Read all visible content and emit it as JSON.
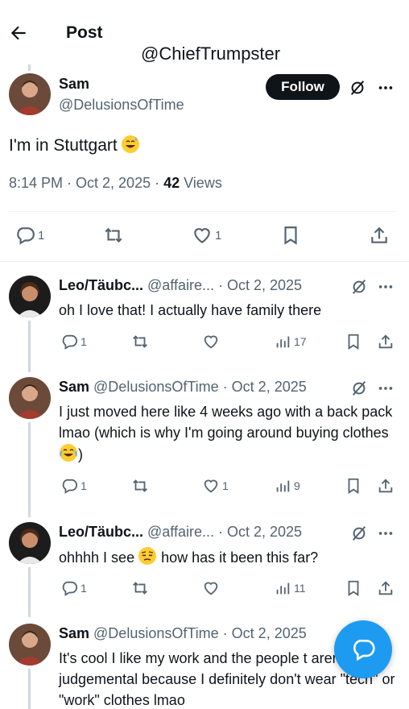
{
  "header": {
    "title": "Post",
    "back_icon": "arrow-left-icon"
  },
  "watermark": "@ChiefTrumpster",
  "main_post": {
    "name": "Sam",
    "handle": "@DelusionsOfTime",
    "follow_label": "Follow",
    "text": "I'm in Stuttgart",
    "text_emoji": "grinning-sweat-emoji",
    "time": "8:14 PM · Oct 2, 2025 · ",
    "views_count": "42",
    "views_label": " Views",
    "actions": {
      "replies": "1",
      "likes": "1"
    }
  },
  "replies": [
    {
      "name": "Leo/Täubc...",
      "meta": " @affaire... · Oct 2, 2025",
      "text": "oh I love that! I actually have family there",
      "reply_count": "1",
      "like_count": "",
      "views": "17"
    },
    {
      "name": "Sam",
      "meta": " @DelusionsOfTime · Oct 2, 2025",
      "text": "I just moved here like 4 weeks ago with a back pack lmao (which is why I'm going around buying clothes",
      "text_after": ")",
      "emoji": "tears-of-joy-emoji",
      "reply_count": "1",
      "like_count": "1",
      "views": "9"
    },
    {
      "name": "Leo/Täubc...",
      "meta": " @affaire... · Oct 2, 2025",
      "text": "ohhhh I see",
      "text_after": " how has it been this far?",
      "emoji": "pensive-emoji",
      "reply_count": "1",
      "like_count": "",
      "views": "11"
    },
    {
      "name": "Sam",
      "meta": " @DelusionsOfTime · Oct 2, 2025",
      "text": "It's cool I like my work and the people t aren't very judgemental because I definitely don't wear \"tech\" or \"work\" clothes lmao"
    }
  ],
  "colors": {
    "accent": "#1d9bf0",
    "secondary_text": "#536471",
    "primary_text": "#0f1419"
  }
}
